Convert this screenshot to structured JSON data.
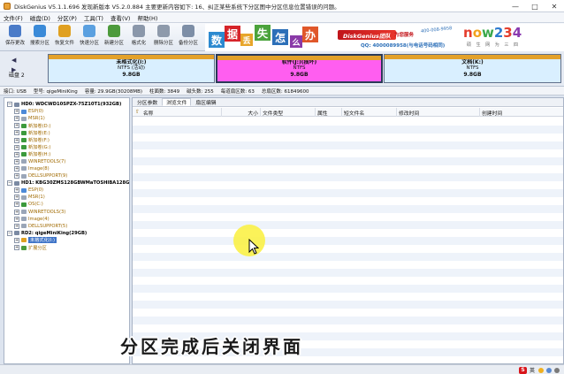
{
  "window": {
    "title": "DiskGenius V5.1.1.696  发现新版本 V5.2.0.884 主要更新内容如下: 16、纠正某些系统下分区图中分区信息位置错误的问题。",
    "minimize": "—",
    "maximize": "□",
    "close": "✕"
  },
  "menu": [
    "文件(F)",
    "磁盘(D)",
    "分区(P)",
    "工具(T)",
    "查看(V)",
    "帮助(H)"
  ],
  "toolbar": [
    {
      "label": "保存更改",
      "icon": "save-icon",
      "color": "#4a7bc8"
    },
    {
      "label": "搜索分区",
      "icon": "search-partition-icon",
      "color": "#3a8ad8"
    },
    {
      "label": "恢复文件",
      "icon": "recover-file-icon",
      "color": "#e0a020"
    },
    {
      "label": "快速分区",
      "icon": "quick-partition-icon",
      "color": "#5aa0e0"
    },
    {
      "label": "新建分区",
      "icon": "new-partition-icon",
      "color": "#4c9a3c"
    },
    {
      "label": "格式化",
      "icon": "format-icon",
      "color": "#8a97aa"
    },
    {
      "label": "删除分区",
      "icon": "delete-partition-icon",
      "color": "#8e9aab"
    },
    {
      "label": "备份分区",
      "icon": "backup-partition-icon",
      "color": "#7d8ea6"
    }
  ],
  "banner": {
    "chars": [
      {
        "text": "数",
        "color": "#2c8ad0"
      },
      {
        "text": "据",
        "color": "#d6242a"
      },
      {
        "text": "丢",
        "color": "#e7a52a"
      },
      {
        "text": "失",
        "color": "#4ba33c"
      },
      {
        "text": "怎",
        "color": "#2c6fb8"
      },
      {
        "text": "么",
        "color": "#8a3aa8"
      },
      {
        "text": "办",
        "color": "#e0572a"
      }
    ],
    "brand": "DiskGenius团队",
    "brand_sub": "为您服务",
    "phone": "400-008-9958",
    "qq": "QQ: 4000089958(与电话号码相同)",
    "logo": "now234",
    "slogan": "硕 生 网 为 三 四"
  },
  "diskmap": {
    "disk_label": "磁盘 2",
    "partitions": [
      {
        "name": "未格式化(I:)",
        "fs": "NTFS (活动)",
        "size": "9.8GB"
      },
      {
        "name": "软件(J:)(损坏)",
        "fs": "NTFS",
        "size": "9.8GB"
      },
      {
        "name": "文档(K:)",
        "fs": "NTFS",
        "size": "9.8GB"
      }
    ]
  },
  "infobar": {
    "iface": "接口: USB",
    "model": "型号: qigeMiniKing",
    "capacity": "容量: 29.9GB(30208MB)",
    "cylinders": "柱面数: 3849",
    "heads": "磁头数: 255",
    "sectors": "每道扇区数: 63",
    "total": "总扇区数: 61849600"
  },
  "tree": [
    {
      "text": "HD0: WDCWD10SPZX-75Z10T1(932GB)",
      "type": "disk",
      "level": 0,
      "toggle": "−"
    },
    {
      "text": "ESP(0)",
      "type": "part",
      "level": 1,
      "toggle": "+",
      "color": "#4d8ad8"
    },
    {
      "text": "MSR(1)",
      "type": "part",
      "level": 1,
      "toggle": "+",
      "color": "#9aa6b8"
    },
    {
      "text": "新加卷(D:)",
      "type": "part",
      "level": 1,
      "toggle": "+",
      "color": "#3c9a3c"
    },
    {
      "text": "新加卷(E:)",
      "type": "part",
      "level": 1,
      "toggle": "+",
      "color": "#3c9a3c"
    },
    {
      "text": "新加卷(F:)",
      "type": "part",
      "level": 1,
      "toggle": "+",
      "color": "#3c9a3c"
    },
    {
      "text": "新加卷(G:)",
      "type": "part",
      "level": 1,
      "toggle": "+",
      "color": "#3c9a3c"
    },
    {
      "text": "新加卷(H:)",
      "type": "part",
      "level": 1,
      "toggle": "+",
      "color": "#3c9a3c"
    },
    {
      "text": "WINRETOOLS(7)",
      "type": "part",
      "level": 1,
      "toggle": "+",
      "color": "#9aa6b8"
    },
    {
      "text": "Image(8)",
      "type": "part",
      "level": 1,
      "toggle": "+",
      "color": "#9aa6b8"
    },
    {
      "text": "DELLSUPPORT(9)",
      "type": "part",
      "level": 1,
      "toggle": "+",
      "color": "#9aa6b8"
    },
    {
      "text": "HD1: KBG30ZMS128GBWMaTOSHIBA128GB",
      "type": "disk",
      "level": 0,
      "toggle": "−"
    },
    {
      "text": "ESP(0)",
      "type": "part",
      "level": 1,
      "toggle": "+",
      "color": "#4d8ad8"
    },
    {
      "text": "MSR(1)",
      "type": "part",
      "level": 1,
      "toggle": "+",
      "color": "#9aa6b8"
    },
    {
      "text": "OS(C:)",
      "type": "part",
      "level": 1,
      "toggle": "+",
      "color": "#3c9a3c"
    },
    {
      "text": "WINRETOOLS(3)",
      "type": "part",
      "level": 1,
      "toggle": "+",
      "color": "#9aa6b8"
    },
    {
      "text": "Image(4)",
      "type": "part",
      "level": 1,
      "toggle": "+",
      "color": "#9aa6b8"
    },
    {
      "text": "DELLSUPPORT(5)",
      "type": "part",
      "level": 1,
      "toggle": "+",
      "color": "#9aa6b8"
    },
    {
      "text": "RD2: qigeMiniKing(29GB)",
      "type": "disk",
      "level": 0,
      "toggle": "−"
    },
    {
      "text": "未格式化(I:)",
      "type": "sel",
      "level": 1,
      "toggle": "+",
      "color": "#e0a020"
    },
    {
      "text": "扩展分区",
      "type": "part",
      "level": 1,
      "toggle": "+",
      "color": "#4c9a3c"
    }
  ],
  "tabs": [
    "分区参数",
    "浏览文件",
    "扇区编辑"
  ],
  "active_tab": 1,
  "columns": [
    "名称",
    "大小",
    "文件类型",
    "属性",
    "短文件名",
    "修改时间",
    "创建时间"
  ],
  "caption": "分区完成后关闭界面",
  "tray": {
    "badge": "S",
    "lang": "英"
  }
}
